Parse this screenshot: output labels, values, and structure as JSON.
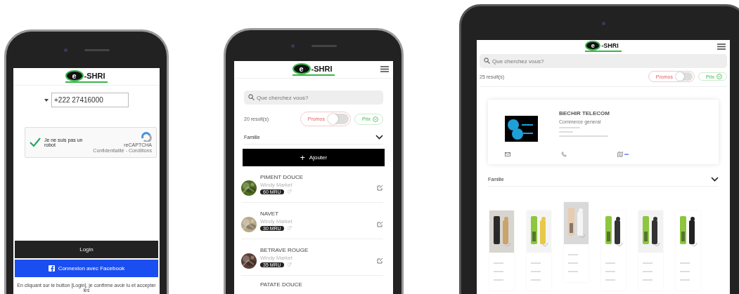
{
  "login_phone": {
    "logo": {
      "letter": "e",
      "name": "-SHRI"
    },
    "phone_field": {
      "value": "+222 27416000"
    },
    "captcha": {
      "label": "Je ne suis pas un robot",
      "checked": true,
      "brand": "reCAPTCHA",
      "links": "Confidentialité - Conditions"
    },
    "login_button": "Login",
    "facebook_button": "Connexion avec Facebook",
    "terms": "En cliquant sur le button [Login], je confirme avoir lu et accepter les"
  },
  "list_phone": {
    "logo": {
      "letter": "e",
      "name": "-SHRI"
    },
    "search": {
      "placeholder": "Que cherchez vous?"
    },
    "results": "20 result(s)",
    "promos": {
      "label": "Promos",
      "on": false
    },
    "price": "Prix",
    "filter": "Famille",
    "add_button": {
      "icon": "+",
      "label": "Ajouter"
    },
    "items": [
      {
        "name": "PIMENT DOUCE",
        "shop": "Windy Market",
        "price": "60 MRU"
      },
      {
        "name": "NAVET",
        "shop": "Windy Market",
        "price": "30 MRU"
      },
      {
        "name": "BETRAVE ROUGE",
        "shop": "Windy Market",
        "price": "35 MRU"
      },
      {
        "name": "PATATE DOUCE"
      }
    ]
  },
  "tablet": {
    "logo": {
      "letter": "e",
      "name": "-SHRI"
    },
    "search": {
      "placeholder": "Que cherchez vous?"
    },
    "results": "25 result(s)",
    "promos": {
      "label": "Promos",
      "on": false
    },
    "price": "Prix",
    "store": {
      "name": "BECHIR TELECOM",
      "category": "Commerce general"
    },
    "filter": "Famille"
  }
}
